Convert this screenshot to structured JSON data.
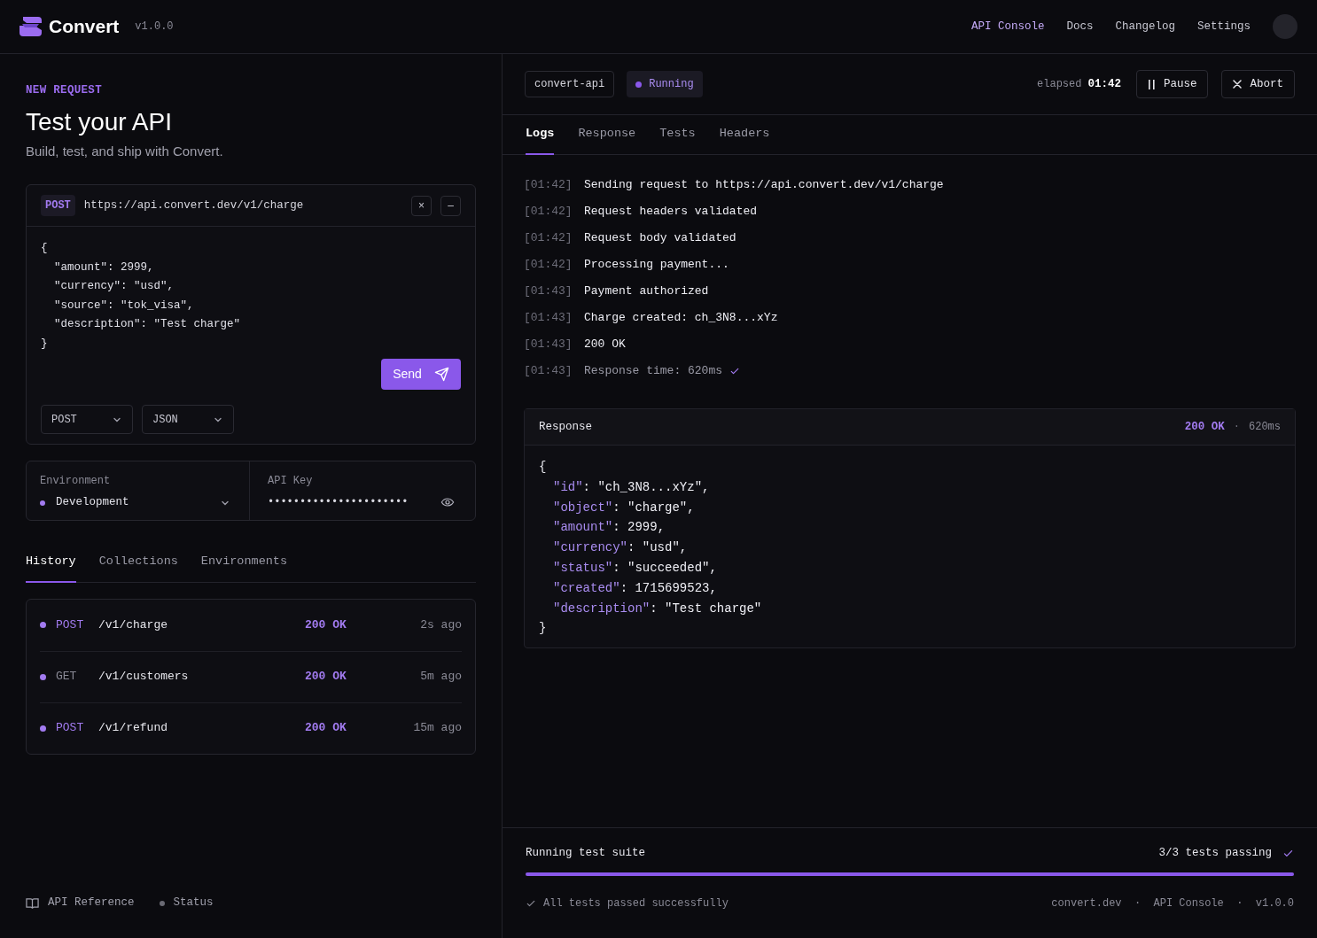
{
  "header": {
    "brand": "Convert",
    "version": "v1.0.0",
    "nav": [
      {
        "label": "API Console",
        "selected": true
      },
      {
        "label": "Docs",
        "selected": false
      },
      {
        "label": "Changelog",
        "selected": false
      },
      {
        "label": "Settings",
        "selected": false
      }
    ]
  },
  "request": {
    "eyebrow": "NEW REQUEST",
    "title": "Test your API",
    "subtitle": "Build, test, and ship with Convert.",
    "method": "POST",
    "url": "https://api.convert.dev/v1/charge",
    "close": "×",
    "minimize": "–",
    "body_lines": [
      "{",
      "  \"amount\": 2999,",
      "  \"currency\": \"usd\",",
      "  \"source\": \"tok_visa\",",
      "  \"description\": \"Test charge\"",
      "}"
    ],
    "send": "Send",
    "selects": [
      "POST",
      "JSON"
    ]
  },
  "environment": {
    "label": "Environment",
    "value": "Development",
    "key_label": "API Key",
    "key_value": "••••••••••••••••••••••"
  },
  "history_tabs": [
    {
      "label": "History",
      "selected": true
    },
    {
      "label": "Collections",
      "selected": false
    },
    {
      "label": "Environments",
      "selected": false
    }
  ],
  "history": [
    {
      "method": "POST",
      "path": "/v1/charge",
      "status": "200 OK",
      "time": "2s ago",
      "color": "#a27bf0"
    },
    {
      "method": "GET",
      "path": "/v1/customers",
      "status": "200 OK",
      "time": "5m ago",
      "color": "#8a8a96"
    },
    {
      "method": "POST",
      "path": "/v1/refund",
      "status": "200 OK",
      "time": "15m ago",
      "color": "#a27bf0"
    }
  ],
  "footer_links": [
    {
      "label": "API Reference",
      "kind": "book"
    },
    {
      "label": "Status",
      "kind": "dot"
    }
  ],
  "run": {
    "project": "convert-api",
    "status": "Running",
    "elapsed_label": "elapsed",
    "elapsed": "01:42",
    "pause": "Pause",
    "abort": "Abort"
  },
  "tabs": [
    {
      "label": "Logs",
      "selected": true
    },
    {
      "label": "Response",
      "selected": false
    },
    {
      "label": "Tests",
      "selected": false
    },
    {
      "label": "Headers",
      "selected": false
    }
  ],
  "logs": [
    {
      "time": "[01:42]",
      "message": "Sending request to https://api.convert.dev/v1/charge",
      "kind": "event"
    },
    {
      "time": "[01:42]",
      "message": "Request headers validated",
      "kind": "event"
    },
    {
      "time": "[01:42]",
      "message": "Request body validated",
      "kind": "event"
    },
    {
      "time": "[01:42]",
      "message": "Processing payment...",
      "kind": "event"
    },
    {
      "time": "[01:43]",
      "message": "Payment authorized",
      "kind": "event"
    },
    {
      "time": "[01:43]",
      "message": "Charge created: ch_3N8...xYz",
      "kind": "event"
    },
    {
      "time": "[01:43]",
      "message": "200 OK",
      "kind": "event"
    },
    {
      "time": "[01:43]",
      "message": "Response time: 620ms",
      "kind": "summary"
    }
  ],
  "response": {
    "title": "Response",
    "status": "200 OK",
    "separator": "·",
    "timing": "620ms",
    "open": "{",
    "close": "}",
    "fields": [
      {
        "key": "\"id\"",
        "value": ": \"ch_3N8...xYz\","
      },
      {
        "key": "\"object\"",
        "value": ": \"charge\","
      },
      {
        "key": "\"amount\"",
        "value": ": 2999,"
      },
      {
        "key": "\"currency\"",
        "value": ": \"usd\","
      },
      {
        "key": "\"status\"",
        "value": ": \"succeeded\","
      },
      {
        "key": "\"created\"",
        "value": ": 1715699523,"
      },
      {
        "key": "\"description\"",
        "value": ": \"Test charge\""
      }
    ]
  },
  "tests": {
    "label": "Running test suite",
    "count": "3/3 tests passing",
    "level": 1,
    "message": "All tests passed successfully",
    "meta": "convert.dev  ·  API Console  ·  v1.0.0"
  }
}
